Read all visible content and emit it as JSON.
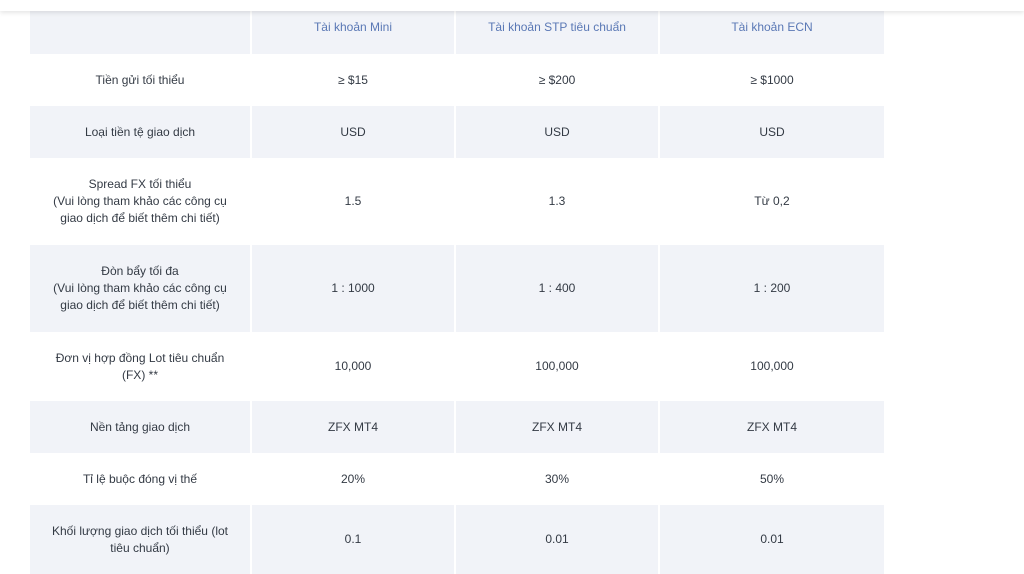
{
  "table": {
    "columns": [
      "",
      "Tài khoản Mini",
      "Tài khoản STP tiêu chuẩn",
      "Tài khoản ECN"
    ],
    "rows": [
      {
        "label": "Tiền gửi tối thiểu",
        "values": [
          "≥ $15",
          "≥ $200",
          "≥ $1000"
        ]
      },
      {
        "label": "Loại tiền tệ giao dịch",
        "values": [
          "USD",
          "USD",
          "USD"
        ]
      },
      {
        "label": "Spread FX tối thiểu\n(Vui lòng tham khảo các công cụ\ngiao dịch để biết thêm chi tiết)",
        "values": [
          "1.5",
          "1.3",
          "Từ 0,2"
        ]
      },
      {
        "label": "Đòn bẩy tối đa\n(Vui lòng tham khảo các công cụ\ngiao dịch để biết thêm chi tiết)",
        "values": [
          "1 : 1000",
          "1 : 400",
          "1 : 200"
        ]
      },
      {
        "label": "Đơn vị hợp đồng Lot tiêu chuẩn\n(FX) **",
        "values": [
          "10,000",
          "100,000",
          "100,000"
        ]
      },
      {
        "label": "Nền tảng giao dịch",
        "values": [
          "ZFX MT4",
          "ZFX MT4",
          "ZFX MT4"
        ]
      },
      {
        "label": "Tỉ lệ buộc đóng vị thế",
        "values": [
          "20%",
          "30%",
          "50%"
        ]
      },
      {
        "label": "Khối lượng giao dịch tối thiểu (lot\ntiêu chuẩn)",
        "values": [
          "0.1",
          "0.01",
          "0.01"
        ]
      }
    ]
  }
}
